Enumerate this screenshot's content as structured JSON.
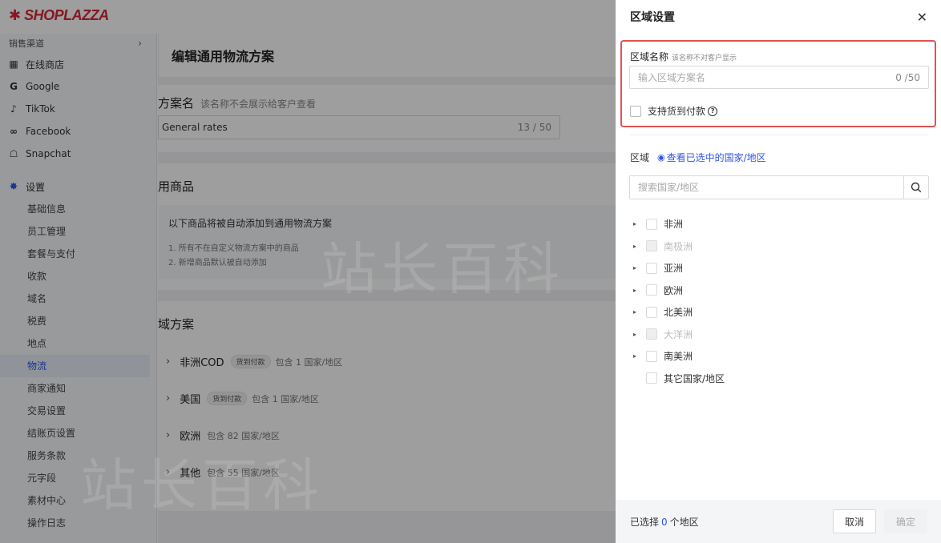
{
  "app": {
    "logo_text": "SHOPLAZZA"
  },
  "sidebar": {
    "section_label": "销售渠道",
    "channels": [
      {
        "label": "在线商店",
        "icon": "store-icon"
      },
      {
        "label": "Google",
        "icon": "google-icon"
      },
      {
        "label": "TikTok",
        "icon": "tiktok-icon"
      },
      {
        "label": "Facebook",
        "icon": "meta-icon"
      },
      {
        "label": "Snapchat",
        "icon": "snapchat-icon"
      }
    ],
    "settings_label": "设置",
    "settings_items": [
      "基础信息",
      "员工管理",
      "套餐与支付",
      "收款",
      "域名",
      "税费",
      "地点",
      "物流",
      "商家通知",
      "交易设置",
      "结账页设置",
      "服务条款",
      "元字段",
      "素材中心",
      "操作日志"
    ],
    "active_item": "物流"
  },
  "main": {
    "page_title": "编辑通用物流方案",
    "plan_name_label": "方案名",
    "plan_name_hint": "该名称不会展示给客户查看",
    "plan_name_value": "General rates",
    "plan_name_count": "13 / 50",
    "products_title": "用商品",
    "notice_title": "以下商品将被自动添加到通用物流方案",
    "notice_lines": [
      "1. 所有不在自定义物流方案中的商品",
      "2. 新增商品默认被自动添加"
    ],
    "zones_title": "域方案",
    "zones": [
      {
        "name": "非洲COD",
        "tag": "货到付款",
        "desc": "包含 1 国家/地区"
      },
      {
        "name": "美国",
        "tag": "货到付款",
        "desc": "包含 1 国家/地区"
      },
      {
        "name": "欧洲",
        "tag": "",
        "desc": "包含 82 国家/地区"
      },
      {
        "name": "其他",
        "tag": "",
        "desc": "包含 55 国家/地区"
      }
    ]
  },
  "drawer": {
    "title": "区域设置",
    "close_icon": "close-icon",
    "zone_name_label": "区域名称",
    "zone_name_hint": "该名称不对客户显示",
    "zone_name_placeholder": "输入区域方案名",
    "zone_name_count": "0 /50",
    "cod_label": "支持货到付款",
    "region_label": "区域",
    "view_selected_link": "查看已选中的国家/地区",
    "search_placeholder": "搜索国家/地区",
    "regions": [
      {
        "label": "非洲",
        "expandable": true,
        "disabled": false
      },
      {
        "label": "南极洲",
        "expandable": true,
        "disabled": true
      },
      {
        "label": "亚洲",
        "expandable": true,
        "disabled": false
      },
      {
        "label": "欧洲",
        "expandable": true,
        "disabled": false
      },
      {
        "label": "北美洲",
        "expandable": true,
        "disabled": false
      },
      {
        "label": "大洋洲",
        "expandable": true,
        "disabled": true
      },
      {
        "label": "南美洲",
        "expandable": true,
        "disabled": false
      },
      {
        "label": "其它国家/地区",
        "expandable": false,
        "disabled": false
      }
    ],
    "footer": {
      "selected_prefix": "已选择",
      "selected_count": "0",
      "selected_suffix": "个地区",
      "cancel_label": "取消",
      "confirm_label": "确定"
    }
  },
  "watermark": "站长百科",
  "colors": {
    "brand": "#d6283a",
    "accent": "#2f54eb",
    "highlight_border": "#e05252"
  }
}
